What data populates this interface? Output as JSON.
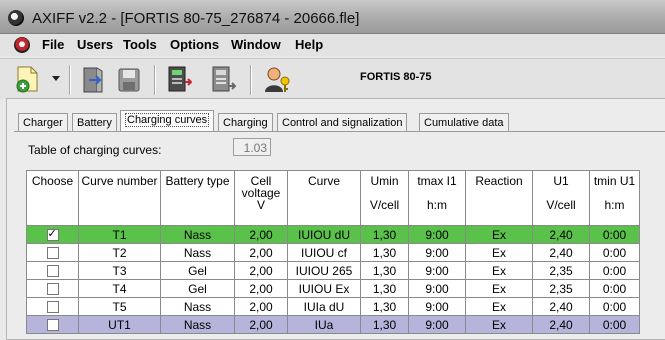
{
  "window": {
    "title": "AXIFF v2.2 - [FORTIS 80-75_276874 - 20666.fle]"
  },
  "menu": [
    "File",
    "Users",
    "Tools",
    "Options",
    "Window",
    "Help"
  ],
  "toolbar": {
    "caption": "FORTIS 80-75"
  },
  "tabs": [
    {
      "label": "Charger",
      "active": false
    },
    {
      "label": "Battery",
      "active": false
    },
    {
      "label": "Charging curves",
      "active": true
    },
    {
      "label": "Charging",
      "active": false
    },
    {
      "label": "Control and signalization",
      "active": false
    },
    {
      "label": "Cumulative data",
      "active": false
    }
  ],
  "charging_curves": {
    "table_label": "Table of charging curves:",
    "table_version": "1.03",
    "columns": [
      "Choose",
      "Curve number",
      "Battery type",
      "Cell voltage V",
      "Curve",
      "Umin",
      "tmax I1",
      "Reaction",
      "U1",
      "tmin U1"
    ],
    "units": [
      "",
      "",
      "",
      "",
      "",
      "V/cell",
      "h:m",
      "",
      "V/cell",
      "h:m"
    ],
    "rows": [
      {
        "checked": true,
        "highlight": "green",
        "cells": [
          "T1",
          "Nass",
          "2,00",
          "IUIOU dU",
          "1,30",
          "9:00",
          "Ex",
          "2,40",
          "0:00"
        ]
      },
      {
        "checked": false,
        "highlight": "none",
        "cells": [
          "T2",
          "Nass",
          "2,00",
          "IUIOU cf",
          "1,30",
          "9:00",
          "Ex",
          "2,40",
          "0:00"
        ]
      },
      {
        "checked": false,
        "highlight": "none",
        "cells": [
          "T3",
          "Gel",
          "2,00",
          "IUIOU 265",
          "1,30",
          "9:00",
          "Ex",
          "2,35",
          "0:00"
        ]
      },
      {
        "checked": false,
        "highlight": "none",
        "cells": [
          "T4",
          "Gel",
          "2,00",
          "IUIOU Ex",
          "1,30",
          "9:00",
          "Ex",
          "2,35",
          "0:00"
        ]
      },
      {
        "checked": false,
        "highlight": "none",
        "cells": [
          "T5",
          "Nass",
          "2,00",
          "IUIa dU",
          "1,30",
          "9:00",
          "Ex",
          "2,40",
          "0:00"
        ]
      },
      {
        "checked": false,
        "highlight": "purple",
        "cells": [
          "UT1",
          "Nass",
          "2,00",
          "IUa",
          "1,30",
          "9:00",
          "Ex",
          "2,40",
          "0:00"
        ]
      }
    ]
  }
}
